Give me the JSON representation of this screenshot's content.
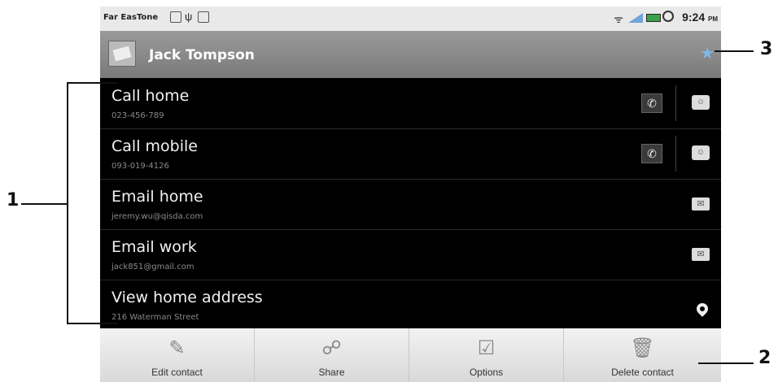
{
  "status_bar": {
    "carrier": "Far EasTone",
    "time": "9:24",
    "ampm": "PM",
    "icons": [
      "gmail-icon",
      "usb-icon",
      "sdcard-icon",
      "wifi-icon",
      "signal-icon",
      "battery-icon",
      "alarm-icon"
    ]
  },
  "contact": {
    "name": "Jack Tompson",
    "favorite_icon": "star-icon",
    "star_color": "#7fb8e8"
  },
  "rows": [
    {
      "title": "Call home",
      "sub": "023-456-789",
      "actions": [
        "call-icon",
        "sms-icon"
      ]
    },
    {
      "title": "Call mobile",
      "sub": "093-019-4126",
      "actions": [
        "call-icon",
        "sms-icon"
      ]
    },
    {
      "title": "Email home",
      "sub": "jeremy.wu@qisda.com",
      "actions": [
        "email-icon"
      ]
    },
    {
      "title": "Email work",
      "sub": "jack851@gmail.com",
      "actions": [
        "email-icon"
      ]
    },
    {
      "title": "View home address",
      "sub": "216 Waterman Street",
      "actions": [
        "map-pin-icon"
      ]
    }
  ],
  "menu": [
    {
      "label": "Edit contact",
      "icon": "pencil-icon"
    },
    {
      "label": "Share",
      "icon": "share-icon"
    },
    {
      "label": "Options",
      "icon": "checklist-icon"
    },
    {
      "label": "Delete contact",
      "icon": "trash-icon"
    }
  ],
  "callouts": {
    "c1": "1",
    "c2": "2",
    "c3": "3"
  }
}
